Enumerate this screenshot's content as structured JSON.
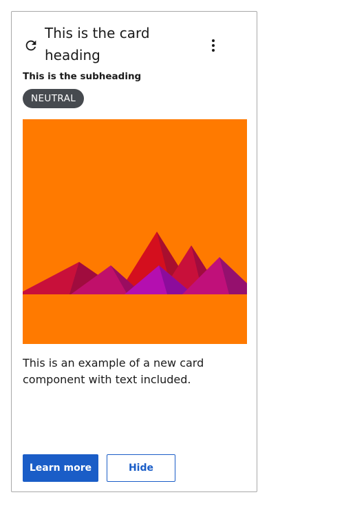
{
  "card": {
    "heading": "This is the card heading",
    "subheading": "This is the subheading",
    "badge": "NEUTRAL",
    "body": "This is an example of a new card component with text included.",
    "actions": {
      "primary_label": "Learn more",
      "secondary_label": "Hide"
    },
    "icons": {
      "refresh": "refresh-icon",
      "menu": "more-vertical-icon"
    }
  },
  "colors": {
    "accent": "#1a5dc7",
    "badge_bg": "#464a4f",
    "image_bg": "#ff7a00",
    "border": "#a8a8a8"
  }
}
